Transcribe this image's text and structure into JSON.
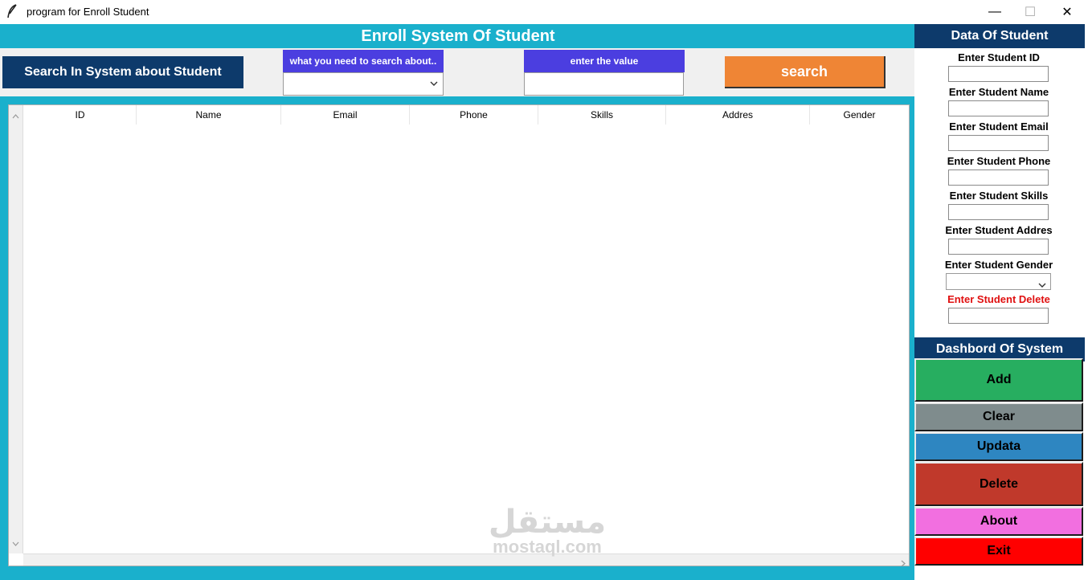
{
  "window": {
    "title": "program for Enroll Student",
    "app_icon": "feather-icon",
    "controls": {
      "minimize": "—",
      "maximize": "☐",
      "close": "✕"
    }
  },
  "header": {
    "title": "Enroll System Of Student"
  },
  "search": {
    "section_label": "Search In System about Student",
    "field_label": "what you need to search about..",
    "field_value": "",
    "value_label": "enter the value",
    "value_input": "",
    "button_label": "search"
  },
  "table": {
    "columns": [
      "ID",
      "Name",
      "Email",
      "Phone",
      "Skills",
      "Addres",
      "Gender"
    ],
    "rows": []
  },
  "data_panel": {
    "title": "Data Of Student",
    "fields": [
      {
        "label": "Enter Student ID",
        "value": ""
      },
      {
        "label": "Enter Student Name",
        "value": ""
      },
      {
        "label": "Enter Student Email",
        "value": ""
      },
      {
        "label": "Enter Student Phone",
        "value": ""
      },
      {
        "label": "Enter Student Skills",
        "value": ""
      },
      {
        "label": "Enter Student Addres",
        "value": ""
      },
      {
        "label": "Enter Student Gender",
        "value": ""
      },
      {
        "label": "Enter Student Delete",
        "value": ""
      }
    ]
  },
  "dashboard": {
    "title": "Dashbord Of System",
    "buttons": [
      {
        "label": "Add",
        "color": "#27ae60"
      },
      {
        "label": "Clear",
        "color": "#7f8c8d"
      },
      {
        "label": "Updata",
        "color": "#2e86c1"
      },
      {
        "label": "Delete",
        "color": "#c0392b"
      },
      {
        "label": "About",
        "color": "#f26fe0"
      },
      {
        "label": "Exit",
        "color": "#ff0000"
      }
    ]
  },
  "colors": {
    "header_bg": "#1ab0cc",
    "navy": "#0d3a6b",
    "label_blue": "#4b3ee0",
    "search_button": "#ef8535",
    "delete_label": "#e01010"
  },
  "watermark": {
    "arabic": "مستقل",
    "latin": "mostaql.com"
  }
}
